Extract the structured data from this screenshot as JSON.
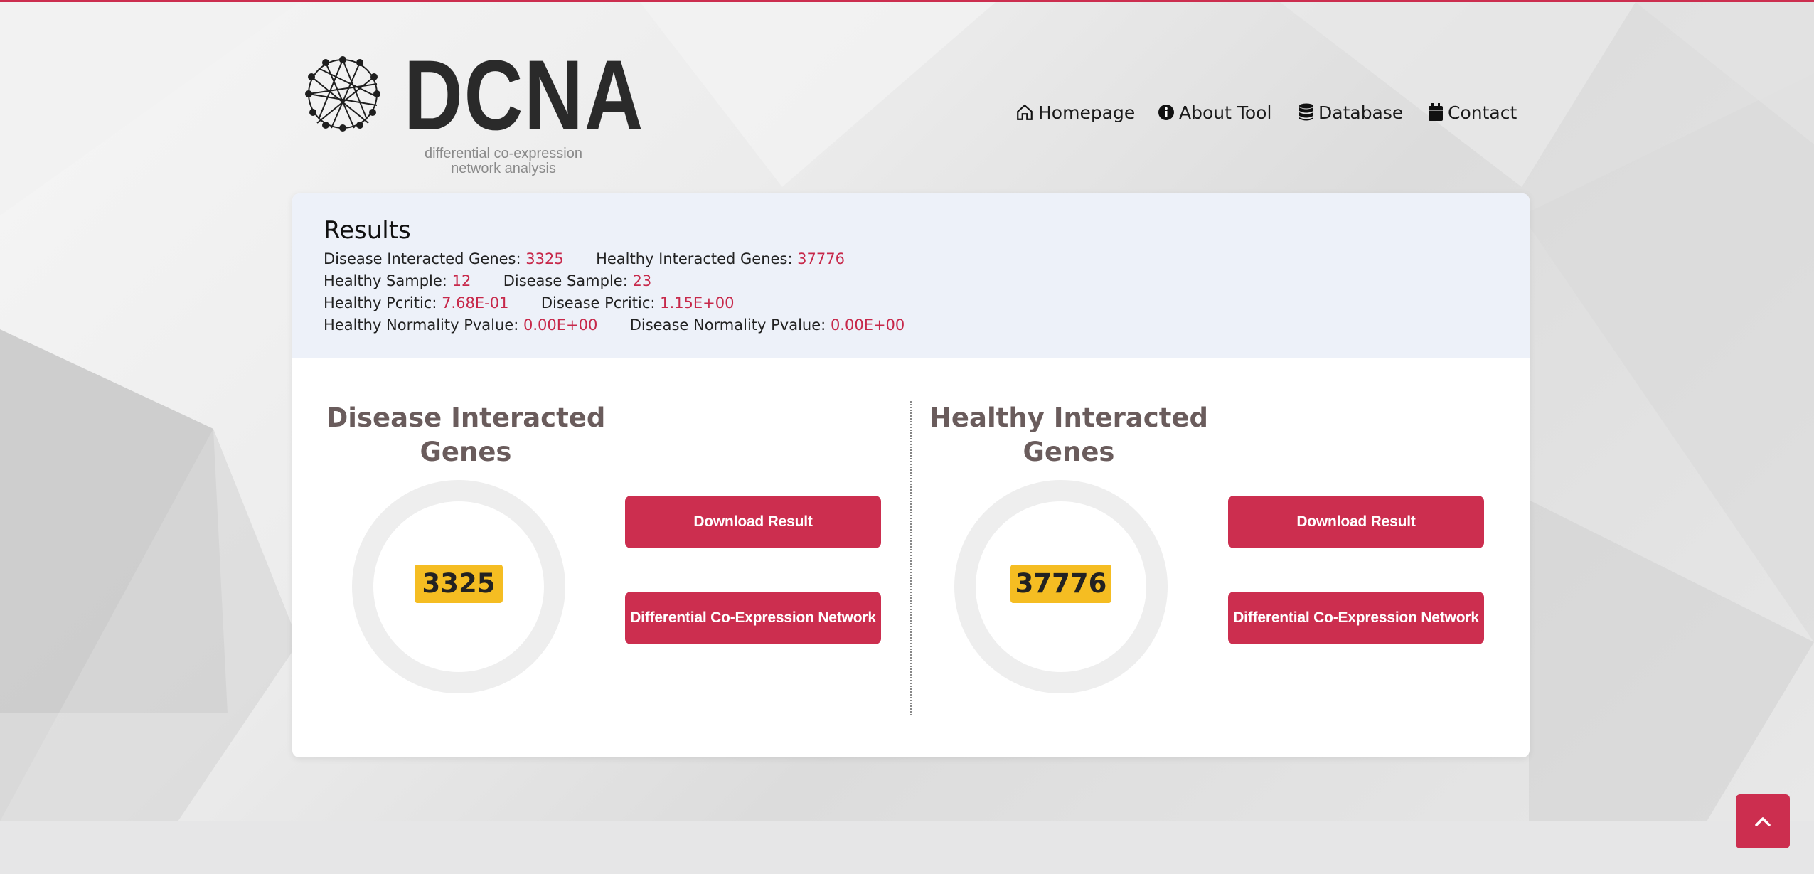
{
  "brand": {
    "name": "DCNA",
    "subtitle_line1": "differential co-expression",
    "subtitle_line2": "network analysis"
  },
  "nav": {
    "items": [
      {
        "label": "Homepage",
        "icon": "home-icon"
      },
      {
        "label": "About Tool",
        "icon": "info-icon"
      },
      {
        "label": "Database",
        "icon": "database-icon"
      },
      {
        "label": "Contact",
        "icon": "calendar-icon"
      }
    ]
  },
  "results": {
    "title": "Results",
    "disease_genes_label": "Disease Interacted Genes:",
    "disease_genes_value": "3325",
    "healthy_genes_label": "Healthy Interacted Genes:",
    "healthy_genes_value": "37776",
    "healthy_sample_label": "Healthy Sample:",
    "healthy_sample_value": "12",
    "disease_sample_label": "Disease Sample:",
    "disease_sample_value": "23",
    "healthy_pcritic_label": "Healthy Pcritic:",
    "healthy_pcritic_value": "7.68E-01",
    "disease_pcritic_label": "Disease Pcritic:",
    "disease_pcritic_value": "1.15E+00",
    "healthy_normality_label": "Healthy Normality Pvalue:",
    "healthy_normality_value": "0.00E+00",
    "disease_normality_label": "Disease Normality Pvalue:",
    "disease_normality_value": "0.00E+00"
  },
  "panels": {
    "disease": {
      "title_line1": "Disease Interacted",
      "title_line2": "Genes",
      "count": "3325",
      "download_label": "Download Result",
      "network_label": "Differential Co-Expression Network"
    },
    "healthy": {
      "title_line1": "Healthy Interacted",
      "title_line2": "Genes",
      "count": "37776",
      "download_label": "Download Result",
      "network_label": "Differential Co-Expression Network"
    }
  },
  "colors": {
    "accent": "#cc2e4f",
    "badge": "#f5bd22",
    "value_text": "#c7284a",
    "summary_bg": "#edf1f9"
  }
}
